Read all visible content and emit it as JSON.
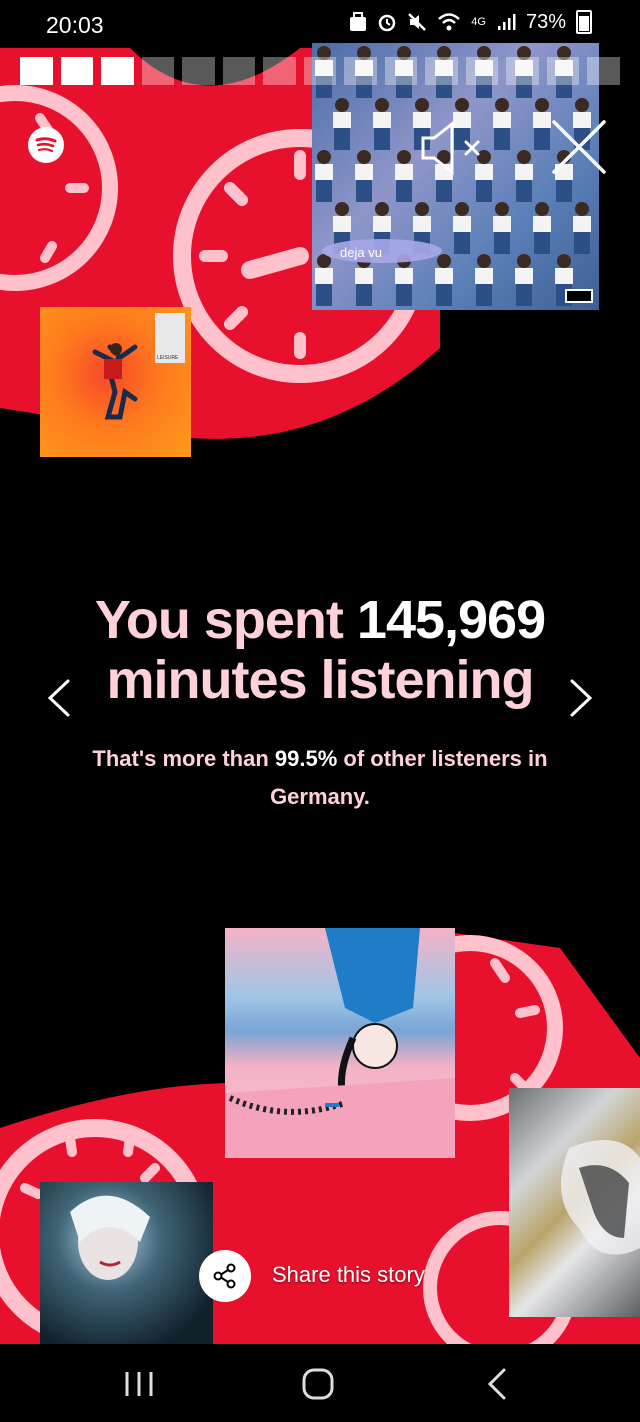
{
  "status_bar": {
    "time": "20:03",
    "network": "4G",
    "battery": "73%"
  },
  "story": {
    "segments_total": 15,
    "segments_done": 3,
    "headline_pre": "You spent ",
    "headline_value": "145,969",
    "headline_post": "minutes listening",
    "subtext_pre": "That's more than ",
    "subtext_value": "99.5%",
    "subtext_post": " of other listeners in Germany.",
    "share_label": "Share this story"
  },
  "covers": {
    "top_right_label": "deja vu",
    "leisure_label": "LEISURE"
  },
  "icons": {
    "logo": "spotify-logo-icon",
    "mute": "volume-mute-icon",
    "close": "close-icon",
    "prev": "chevron-left-icon",
    "next": "chevron-right-icon",
    "share": "share-icon",
    "nav_recents": "recent-apps-icon",
    "nav_home": "home-icon",
    "nav_back": "back-icon"
  },
  "colors": {
    "accent_red": "#e8112d",
    "clock_pink": "#ffc2cc",
    "headline_pink": "#ffd1d8",
    "background": "#000000"
  }
}
